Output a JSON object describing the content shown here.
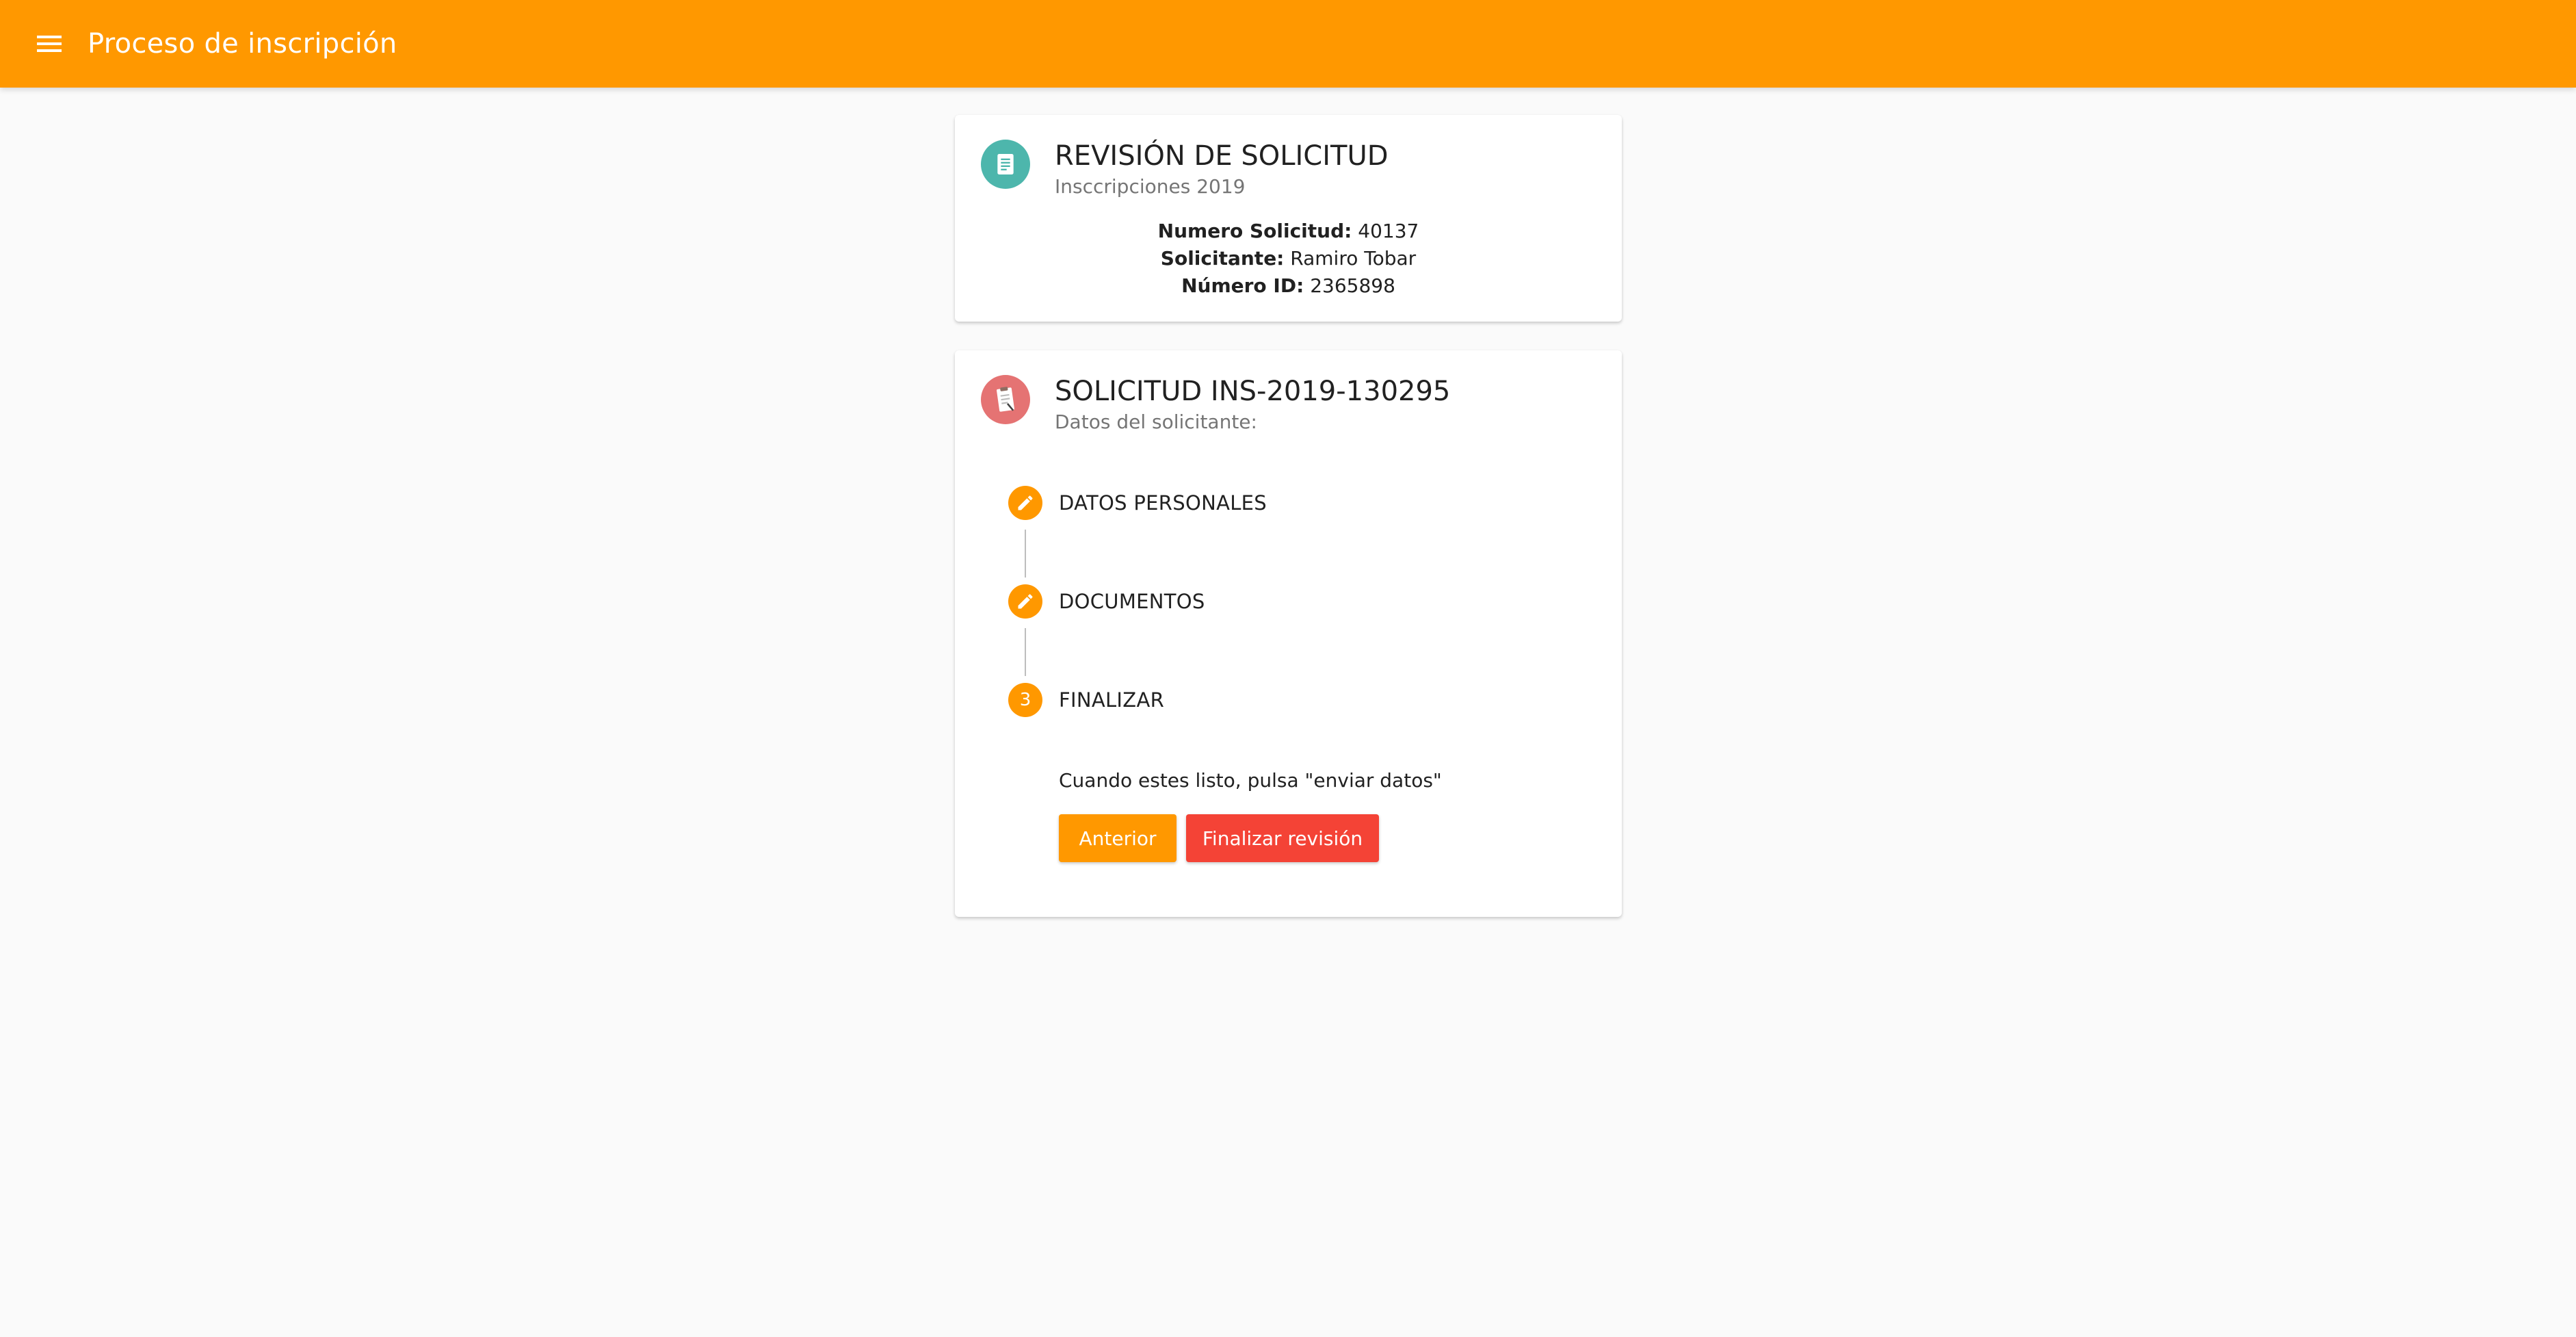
{
  "appbar": {
    "title": "Proceso de inscripción",
    "color": "#ff9800",
    "menu_icon": "menu-icon"
  },
  "review_card": {
    "icon": "document-icon",
    "title": "REVISIÓN DE SOLICITUD",
    "subtitle": "Insccripciones 2019",
    "fields": [
      {
        "label": "Numero Solicitud:",
        "value": "40137"
      },
      {
        "label": "Solicitante:",
        "value": "Ramiro Tobar"
      },
      {
        "label": "Número ID:",
        "value": "2365898"
      }
    ]
  },
  "request_card": {
    "icon": "clipboard-icon",
    "title": "SOLICITUD INS-2019-130295",
    "subtitle": "Datos del solicitante:",
    "steps": [
      {
        "label": "DATOS PERSONALES",
        "icon": "edit-icon",
        "state": "edit"
      },
      {
        "label": "DOCUMENTOS",
        "icon": "edit-icon",
        "state": "edit"
      },
      {
        "label": "FINALIZAR",
        "number": "3",
        "state": "active"
      }
    ],
    "finish_text": "Cuando estes listo, pulsa \"enviar datos\"",
    "buttons": {
      "previous": "Anterior",
      "finish": "Finalizar revisión"
    }
  },
  "colors": {
    "accent": "#ff9800",
    "danger": "#f44336",
    "teal": "#4db6ac",
    "red_avatar": "#e57373"
  }
}
